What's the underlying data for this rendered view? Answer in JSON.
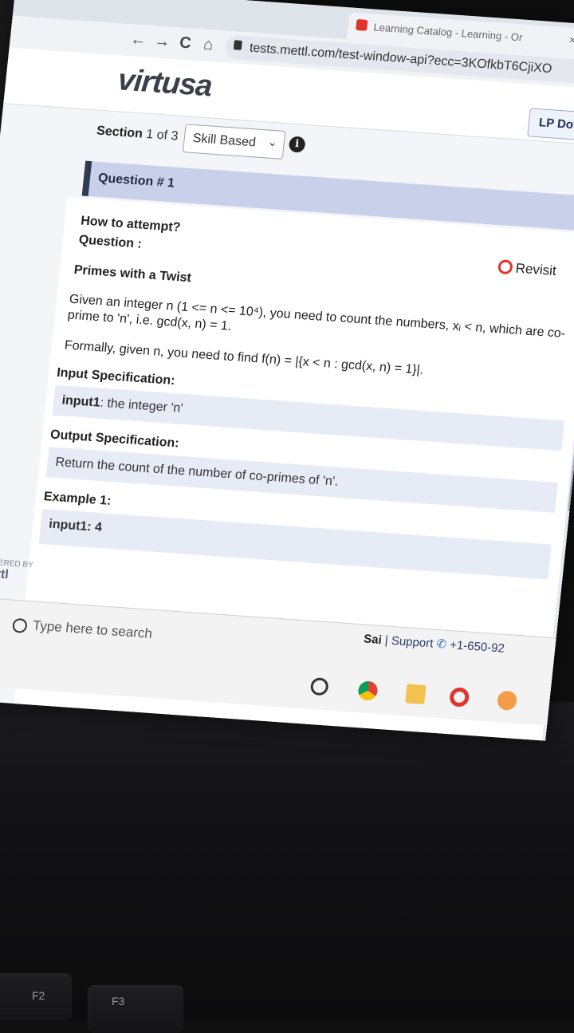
{
  "browser": {
    "tab_title": "Learning Catalog - Learning - Or",
    "tab_close": "×",
    "back": "←",
    "forward": "→",
    "reload": "C",
    "home": "⌂",
    "url": "tests.mettl.com/test-window-api?ecc=3KOfkbT6CjiXO"
  },
  "header": {
    "logo": "virtusa",
    "lp_button": "LP Dotn"
  },
  "section": {
    "label": "Section",
    "current": "1",
    "of": "of 3",
    "selected": "Skill Based",
    "caret": "⌄",
    "info": "i"
  },
  "question": {
    "header": "Question # 1",
    "how_to_attempt": "How to attempt?",
    "question_label": "Question :",
    "revisit": "Revisit",
    "title": "Primes with a Twist",
    "para1": "Given an integer n (1 <= n <= 10⁴), you need to count the numbers, xᵢ < n, which are co-prime to 'n', i.e. gcd(x, n) = 1.",
    "para2": "Formally, given n, you need to find f(n) = |{x < n : gcd(x, n) = 1}|.",
    "input_spec_heading": "Input Specification:",
    "input_spec_key": "input1",
    "input_spec_text": ": the integer 'n'",
    "output_spec_heading": "Output Specification:",
    "output_spec_text": "Return the count of the number of co-primes of 'n'.",
    "example_heading": "Example 1:",
    "example_input": "input1: 4"
  },
  "footer": {
    "powered": "POWERED BY",
    "brand": "mettl"
  },
  "taskbar": {
    "search_placeholder": "Type here to search",
    "user": "Sai",
    "separator": " | ",
    "support": "Support",
    "phone": "+1-650-92"
  },
  "keyboard": {
    "f2": "F2",
    "f3": "F3"
  }
}
